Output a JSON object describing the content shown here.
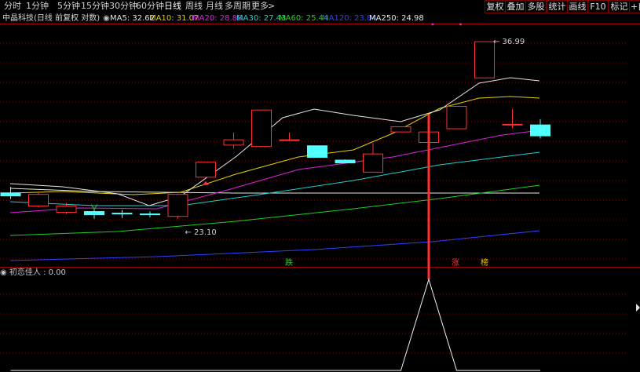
{
  "toolbar": {
    "periods": [
      "分时",
      "1分钟",
      "5分钟",
      "15分钟",
      "30分钟",
      "60分钟",
      "日线",
      "周线",
      "月线",
      "多周期",
      "更多"
    ],
    "active_period": "日线",
    "buttons": [
      "复权",
      "叠加",
      "多股",
      "统计",
      "画线",
      "F10",
      "标记",
      "+自"
    ]
  },
  "header": {
    "stock_title": "中晶科技(日线 前复权 对数)"
  },
  "indicator": {
    "title": "初恋佳人 : 0.00"
  },
  "chart_data": [
    {
      "type": "candlestick",
      "candles": [
        {
          "open": 24.75,
          "close": 24.55,
          "high": 25.15,
          "low": 24.35
        },
        {
          "open": 23.9,
          "close": 24.65,
          "high": 24.85,
          "low": 23.8
        },
        {
          "open": 23.5,
          "close": 23.9,
          "high": 24.1,
          "low": 23.4
        },
        {
          "open": 23.55,
          "close": 23.35,
          "high": 23.75,
          "low": 23.1
        },
        {
          "open": 23.45,
          "close": 23.4,
          "high": 23.65,
          "low": 23.15
        },
        {
          "open": 23.4,
          "close": 23.35,
          "high": 23.55,
          "low": 23.2
        },
        {
          "open": 23.25,
          "close": 24.65,
          "high": 24.7,
          "low": 23.1
        },
        {
          "open": 25.8,
          "close": 26.85,
          "high": 26.85,
          "low": 25.8
        },
        {
          "open": 28.1,
          "close": 28.5,
          "high": 29.05,
          "low": 27.85
        },
        {
          "open": 28.0,
          "close": 30.85,
          "high": 30.85,
          "low": 28.0
        },
        {
          "open": 28.5,
          "close": 28.5,
          "high": 29.05,
          "low": 28.4
        },
        {
          "open": 28.05,
          "close": 27.2,
          "high": 28.05,
          "low": 27.2
        },
        {
          "open": 27.0,
          "close": 26.8,
          "high": 27.05,
          "low": 26.8
        },
        {
          "open": 26.15,
          "close": 27.45,
          "high": 28.25,
          "low": 26.15
        },
        {
          "open": 29.1,
          "close": 29.5,
          "high": 29.5,
          "low": 29.1
        },
        {
          "open": 28.3,
          "close": 29.1,
          "high": 29.85,
          "low": 28.05
        },
        {
          "open": 29.35,
          "close": 31.15,
          "high": 31.15,
          "low": 29.35
        },
        {
          "open": 33.6,
          "close": 36.99,
          "high": 36.99,
          "low": 33.6
        },
        {
          "open": 29.7,
          "close": 29.7,
          "high": 30.95,
          "low": 29.4
        },
        {
          "open": 29.65,
          "close": 28.8,
          "high": 30.1,
          "low": 28.6
        }
      ],
      "moving_averages": [
        {
          "name": "MA5",
          "value": 32.62,
          "color": "#e6e6e6"
        },
        {
          "name": "MA10",
          "value": 31.07,
          "color": "#e8d000"
        },
        {
          "name": "MA20",
          "value": 28.88,
          "color": "#e020e0"
        },
        {
          "name": "MA30",
          "value": 27.43,
          "color": "#20d0d0"
        },
        {
          "name": "MA60",
          "value": 25.44,
          "color": "#20d020"
        },
        {
          "name": "MA120",
          "value": 23.84,
          "color": "#3040ff"
        },
        {
          "name": "MA250",
          "value": 24.98,
          "color": "#e6e6e6"
        }
      ],
      "annotations": [
        {
          "text": "36.99",
          "kind": "high"
        },
        {
          "text": "23.10",
          "kind": "low"
        }
      ],
      "markers": [
        "跌",
        "涨",
        "榜"
      ],
      "y_scale": "log"
    },
    {
      "type": "line",
      "name": "初恋佳人",
      "values": [
        0,
        0,
        0,
        0,
        0,
        0,
        0,
        0,
        0,
        0,
        0,
        0,
        0,
        0,
        0,
        1,
        0,
        0,
        0,
        0
      ]
    }
  ],
  "colors": {
    "up": "#ff3030",
    "down": "#50ffff",
    "grid": "#8a0000",
    "border": "#a00000"
  }
}
